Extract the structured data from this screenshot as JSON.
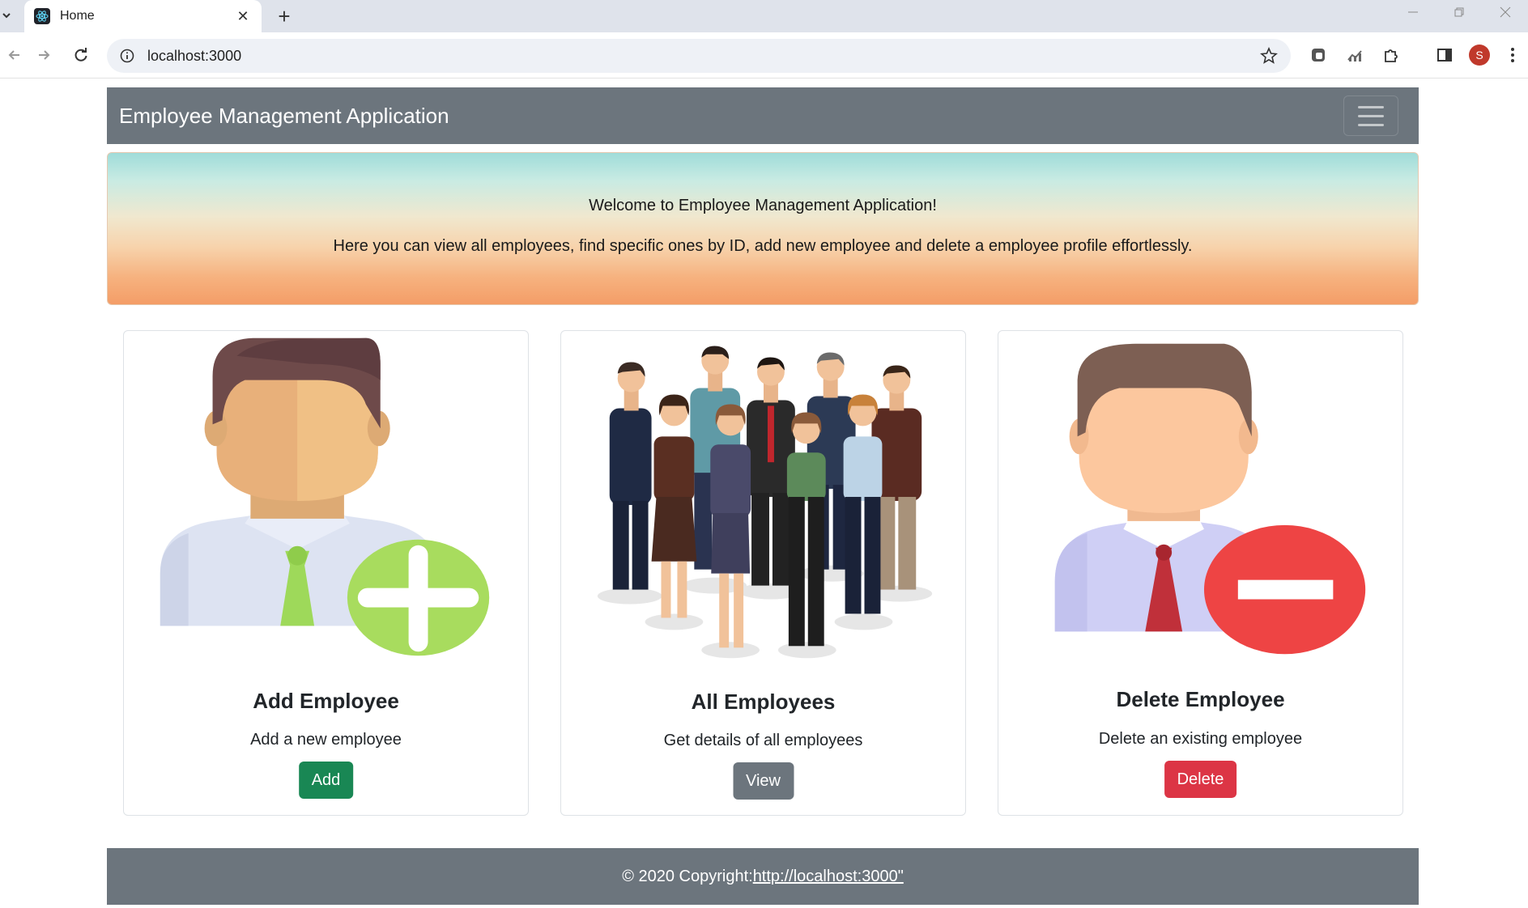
{
  "browser": {
    "tab_title": "Home",
    "new_tab_symbol": "+",
    "close_symbol": "✕",
    "address": "localhost:3000",
    "profile_initial": "S"
  },
  "navbar": {
    "brand": "Employee Management Application"
  },
  "jumbotron": {
    "heading": "Welcome to Employee Management Application!",
    "text": "Here you can view all employees, find specific ones by ID, add new employee and delete a employee profile effortlessly."
  },
  "cards": [
    {
      "title": "Add Employee",
      "text": "Add a new employee",
      "button": "Add",
      "button_color": "#198754"
    },
    {
      "title": "All Employees",
      "text": "Get details of all employees",
      "button": "View",
      "button_color": "#6c757d"
    },
    {
      "title": "Delete Employee",
      "text": "Delete an existing employee",
      "button": "Delete",
      "button_color": "#dc3545"
    }
  ],
  "footer": {
    "prefix": "© 2020 Copyright:",
    "link": "http://localhost:3000\""
  },
  "icons": [
    "react-favicon",
    "info-icon",
    "star-icon",
    "extension-icon",
    "sidebar-icon",
    "menu-icon",
    "hamburger-icon",
    "plus-badge-icon",
    "minus-badge-icon"
  ],
  "colors": {
    "navbar": "#6c757d",
    "add": "#198754",
    "view": "#6c757d",
    "delete": "#dc3545"
  }
}
